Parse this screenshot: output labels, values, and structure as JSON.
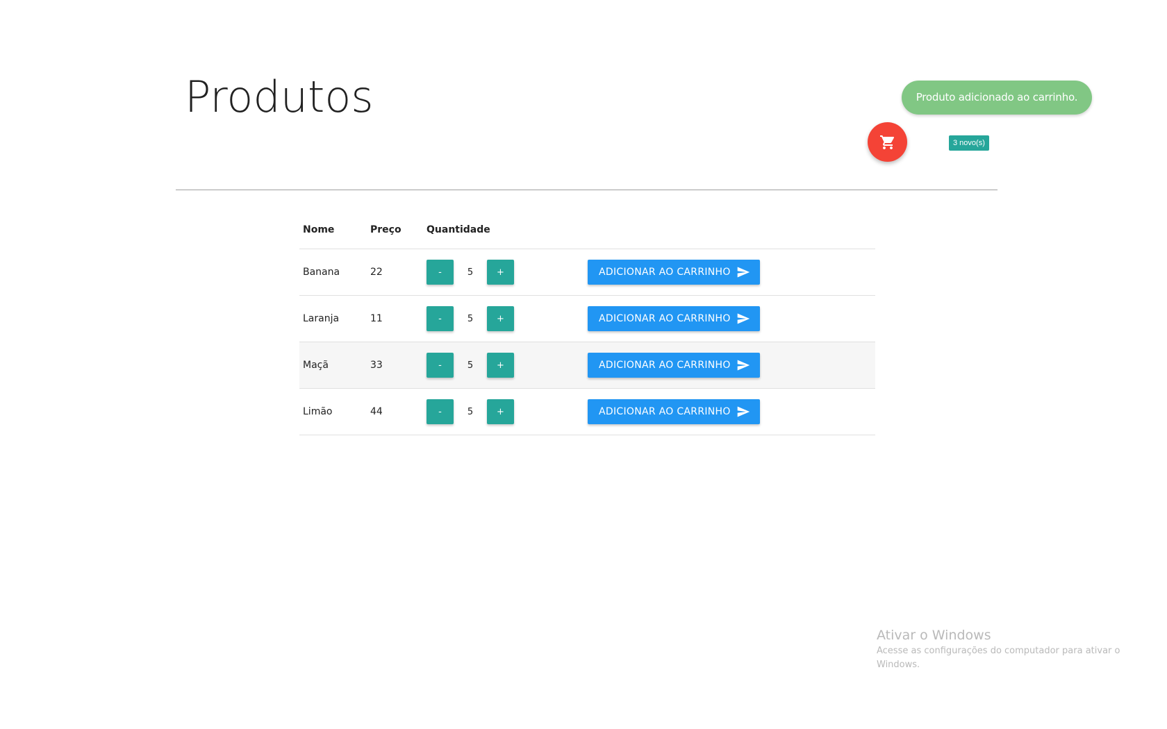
{
  "header": {
    "title": "Produtos"
  },
  "toast": {
    "message": "Produto adicionado ao carrinho."
  },
  "cart": {
    "icon": "shopping-cart-icon",
    "badge": "3 novo(s)"
  },
  "table": {
    "columns": [
      "Nome",
      "Preço",
      "Quantidade"
    ],
    "add_label": "ADICIONAR AO CARRINHO",
    "minus_label": "-",
    "plus_label": "+",
    "rows": [
      {
        "name": "Banana",
        "price": "22",
        "quantity": "5"
      },
      {
        "name": "Laranja",
        "price": "11",
        "quantity": "5"
      },
      {
        "name": "Maçã",
        "price": "33",
        "quantity": "5"
      },
      {
        "name": "Limão",
        "price": "44",
        "quantity": "5"
      }
    ]
  },
  "watermark": {
    "title": "Ativar o Windows",
    "subtitle": "Acesse as configurações do computador para ativar o Windows."
  },
  "colors": {
    "fab": "#f44336",
    "toast": "#81c784",
    "teal": "#26a69a",
    "primary": "#2196f3"
  }
}
